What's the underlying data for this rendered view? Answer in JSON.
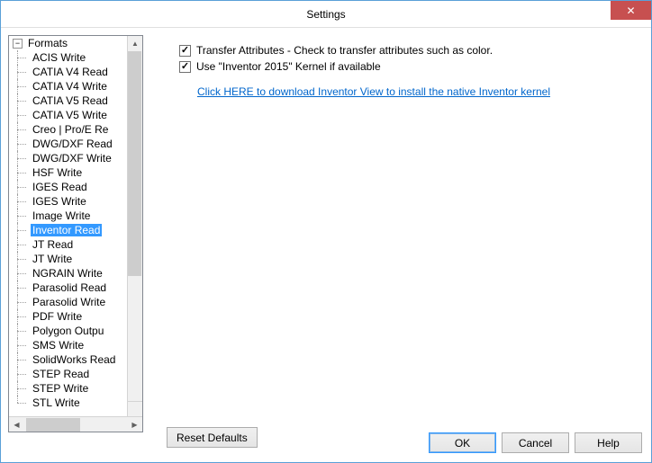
{
  "window": {
    "title": "Settings",
    "close_glyph": "✕"
  },
  "tree": {
    "root_label": "Formats",
    "expander_glyph": "−",
    "items": [
      {
        "label": "ACIS Write",
        "selected": false
      },
      {
        "label": "CATIA V4 Read",
        "selected": false
      },
      {
        "label": "CATIA V4 Write",
        "selected": false
      },
      {
        "label": "CATIA V5 Read",
        "selected": false
      },
      {
        "label": "CATIA V5 Write",
        "selected": false
      },
      {
        "label": "Creo | Pro/E Re",
        "selected": false
      },
      {
        "label": "DWG/DXF Read",
        "selected": false
      },
      {
        "label": "DWG/DXF Write",
        "selected": false
      },
      {
        "label": "HSF Write",
        "selected": false
      },
      {
        "label": "IGES Read",
        "selected": false
      },
      {
        "label": "IGES Write",
        "selected": false
      },
      {
        "label": "Image Write",
        "selected": false
      },
      {
        "label": "Inventor Read",
        "selected": true
      },
      {
        "label": "JT Read",
        "selected": false
      },
      {
        "label": "JT Write",
        "selected": false
      },
      {
        "label": "NGRAIN Write",
        "selected": false
      },
      {
        "label": "Parasolid Read",
        "selected": false
      },
      {
        "label": "Parasolid Write",
        "selected": false
      },
      {
        "label": "PDF Write",
        "selected": false
      },
      {
        "label": "Polygon Outpu",
        "selected": false
      },
      {
        "label": "SMS Write",
        "selected": false
      },
      {
        "label": "SolidWorks Read",
        "selected": false
      },
      {
        "label": "STEP Read",
        "selected": false
      },
      {
        "label": "STEP Write",
        "selected": false
      },
      {
        "label": "STL Write",
        "selected": false
      }
    ]
  },
  "options": {
    "transfer_attributes": {
      "checked": true,
      "label": "Transfer Attributes - Check to transfer attributes such as color."
    },
    "use_kernel": {
      "checked": true,
      "label": "Use \"Inventor 2015\" Kernel if available"
    },
    "download_link": "Click HERE to download Inventor View to install the native Inventor kernel"
  },
  "buttons": {
    "reset": "Reset Defaults",
    "ok": "OK",
    "cancel": "Cancel",
    "help": "Help"
  }
}
